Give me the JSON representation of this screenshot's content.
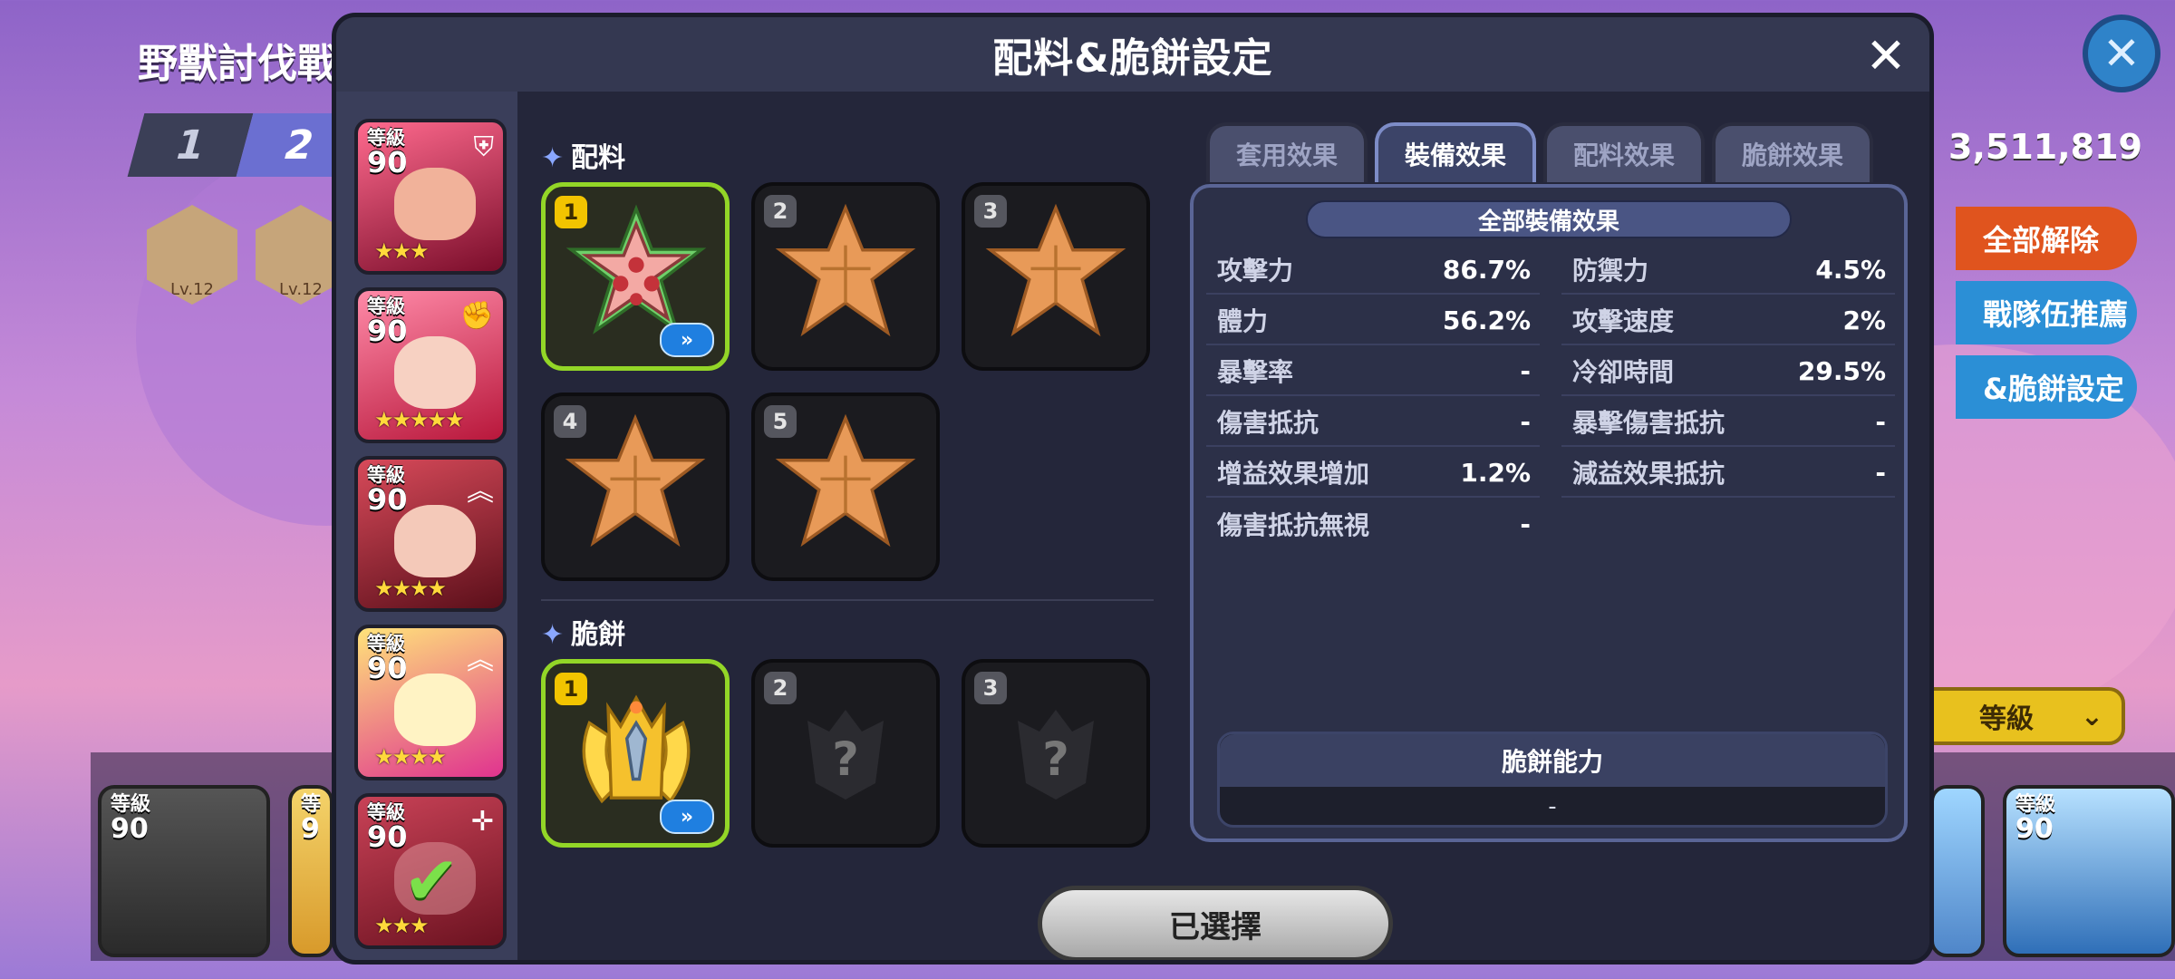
{
  "background": {
    "title": "野獸討伐戰",
    "team_tabs": [
      "1",
      "2"
    ],
    "hex_levels": [
      "Lv.12",
      "Lv.12"
    ],
    "score": "3,511,819",
    "side_buttons": [
      {
        "label": "全部解除",
        "color": "#e0541e"
      },
      {
        "label": "戰隊伍推薦",
        "color": "#2b8fd6"
      },
      {
        "label": "&脆餅設定",
        "color": "#2b8fd6"
      }
    ],
    "sort_label": "等級",
    "bottom_cards": [
      {
        "level_label": "等級",
        "level": "90"
      },
      {
        "level_label": "等",
        "level": "9"
      },
      {
        "level_label": "等級",
        "level": "90"
      }
    ]
  },
  "modal": {
    "title": "配料&脆餅設定",
    "close_icon": "close-icon",
    "cookies": [
      {
        "level_label": "等級",
        "level": "90",
        "stars": "★★★",
        "badge": "shield-icon",
        "color": "#c0224a"
      },
      {
        "level_label": "等級",
        "level": "90",
        "stars": "★★★★★",
        "badge": "fist-icon",
        "color": "#c42a3e"
      },
      {
        "level_label": "等級",
        "level": "90",
        "stars": "★★★★",
        "badge": "chevron-up-icon",
        "color": "#8e1f2b"
      },
      {
        "level_label": "等級",
        "level": "90",
        "stars": "★★★★",
        "badge": "chevron-up-icon",
        "color": "#e44a9d"
      },
      {
        "level_label": "等級",
        "level": "90",
        "stars": "★★★",
        "badge": "crosshair-icon",
        "color": "#b5243b",
        "selected": true
      }
    ],
    "toppings_label": "配料",
    "toppings": [
      "1",
      "2",
      "3",
      "4",
      "5"
    ],
    "biscuit_label": "脆餅",
    "biscuits": [
      "1",
      "2",
      "3"
    ],
    "tabs": [
      "套用效果",
      "裝備效果",
      "配料效果",
      "脆餅效果"
    ],
    "active_tab": "裝備效果",
    "panel_header": "全部裝備效果",
    "stats_left": [
      {
        "name": "攻擊力",
        "value": "86.7%"
      },
      {
        "name": "體力",
        "value": "56.2%"
      },
      {
        "name": "暴擊率",
        "value": "-"
      },
      {
        "name": "傷害抵抗",
        "value": "-"
      },
      {
        "name": "增益效果增加",
        "value": "1.2%"
      },
      {
        "name": "傷害抵抗無視",
        "value": "-"
      }
    ],
    "stats_right": [
      {
        "name": "防禦力",
        "value": "4.5%"
      },
      {
        "name": "攻擊速度",
        "value": "2%"
      },
      {
        "name": "冷卻時間",
        "value": "29.5%"
      },
      {
        "name": "暴擊傷害抵抗",
        "value": "-"
      },
      {
        "name": "減益效果抵抗",
        "value": "-"
      }
    ],
    "ability_title": "脆餅能力",
    "ability_value": "-",
    "confirm_label": "已選擇"
  }
}
